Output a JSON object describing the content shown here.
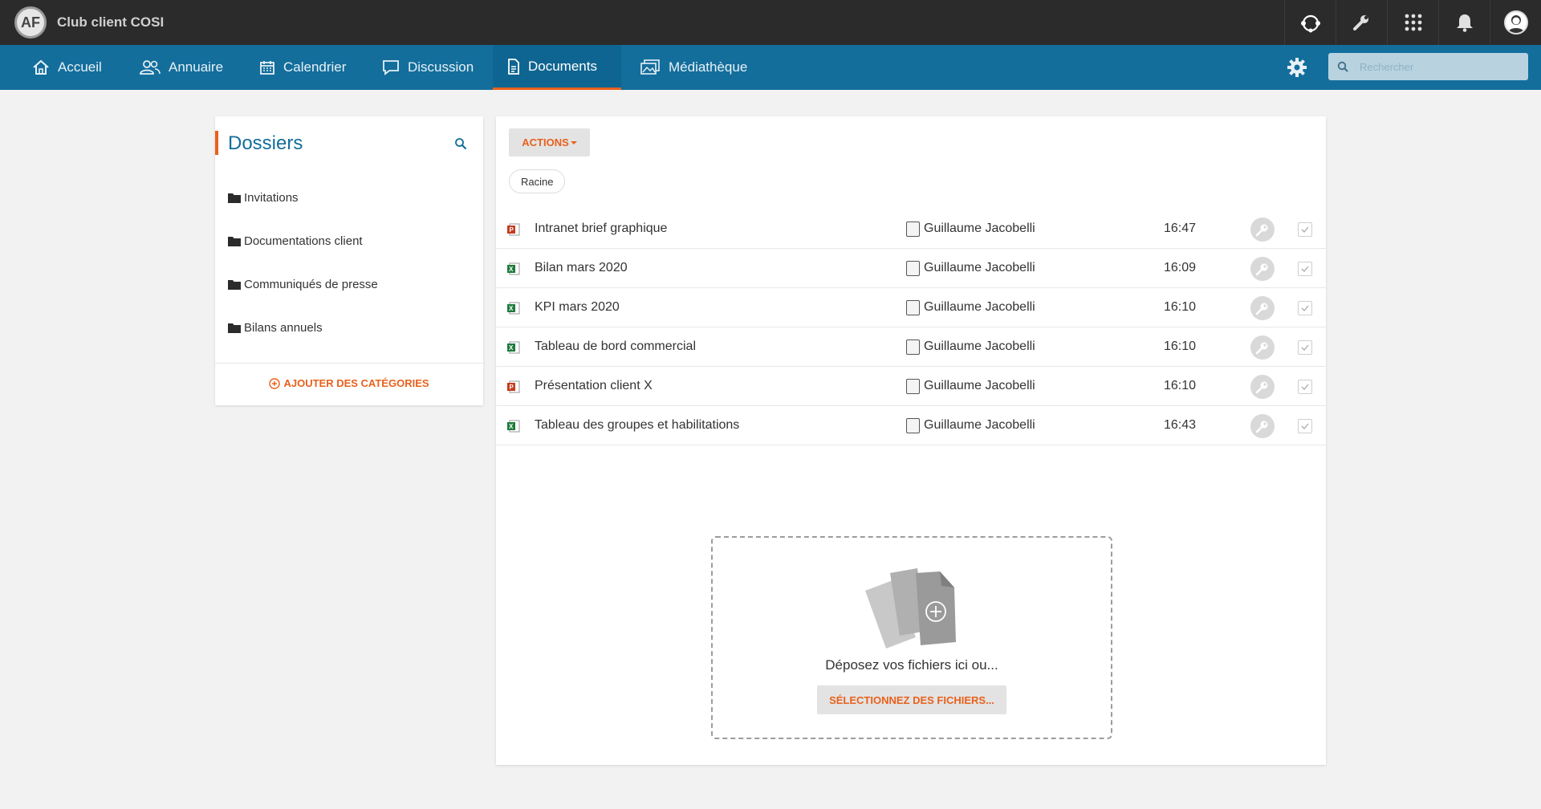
{
  "app": {
    "title": "Club client COSI",
    "logo_text": "AF"
  },
  "topbar": {
    "icons": [
      "support-icon",
      "wrench-icon",
      "apps-grid-icon",
      "bell-icon",
      "user-avatar"
    ]
  },
  "nav": {
    "items": [
      {
        "label": "Accueil",
        "icon": "home-icon"
      },
      {
        "label": "Annuaire",
        "icon": "users-icon"
      },
      {
        "label": "Calendrier",
        "icon": "calendar-icon"
      },
      {
        "label": "Discussion",
        "icon": "chat-icon"
      },
      {
        "label": "Documents",
        "icon": "document-icon",
        "active": true
      },
      {
        "label": "Médiathèque",
        "icon": "media-icon"
      }
    ],
    "search_placeholder": "Rechercher"
  },
  "folders": {
    "title": "Dossiers",
    "items": [
      {
        "label": "Invitations"
      },
      {
        "label": "Documentations client"
      },
      {
        "label": "Communiqués de presse"
      },
      {
        "label": "Bilans annuels"
      }
    ],
    "add_label": "AJOUTER DES CATÉGORIES"
  },
  "documents": {
    "actions_label": "ACTIONS",
    "breadcrumb": "Racine",
    "files": [
      {
        "name": "Intranet brief graphique",
        "type": "powerpoint",
        "owner": "Guillaume Jacobelli",
        "time": "16:47"
      },
      {
        "name": "Bilan mars 2020",
        "type": "excel",
        "owner": "Guillaume Jacobelli",
        "time": "16:09"
      },
      {
        "name": "KPI mars 2020",
        "type": "excel",
        "owner": "Guillaume Jacobelli",
        "time": "16:10"
      },
      {
        "name": "Tableau de bord commercial",
        "type": "excel",
        "owner": "Guillaume Jacobelli",
        "time": "16:10"
      },
      {
        "name": "Présentation client X",
        "type": "powerpoint",
        "owner": "Guillaume Jacobelli",
        "time": "16:10"
      },
      {
        "name": "Tableau des groupes et habilitations",
        "type": "excel",
        "owner": "Guillaume Jacobelli",
        "time": "16:43"
      }
    ],
    "dropzone": {
      "text": "Déposez vos fichiers ici ou...",
      "button_label": "SÉLECTIONNEZ DES FICHIERS..."
    }
  },
  "colors": {
    "topbar": "#2b2b2b",
    "nav": "#136e9c",
    "accent": "#e8611c",
    "excel": "#1e7b3c",
    "powerpoint": "#c43b1d"
  }
}
